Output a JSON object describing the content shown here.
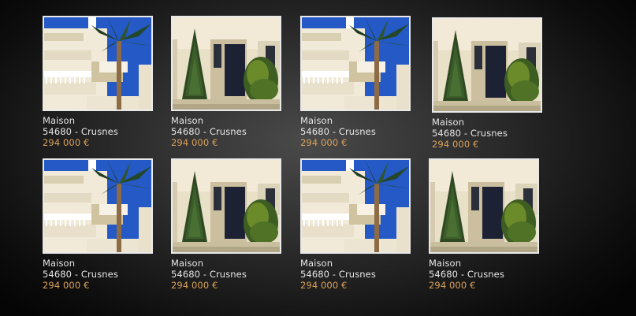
{
  "listings": [
    {
      "type": "Maison",
      "location": "54680 - Crusnes",
      "price": "294 000 €",
      "image": "white-apartment-balconies-palm-photo"
    },
    {
      "type": "Maison",
      "location": "54680 - Crusnes",
      "price": "294 000 €",
      "image": "cream-house-door-cypress-photo"
    },
    {
      "type": "Maison",
      "location": "54680 - Crusnes",
      "price": "294 000 €",
      "image": "white-apartment-balconies-palm-photo"
    },
    {
      "type": "Maison",
      "location": "54680 - Crusnes",
      "price": "294 000 €",
      "image": "cream-house-door-cypress-photo"
    },
    {
      "type": "Maison",
      "location": "54680 - Crusnes",
      "price": "294 000 €",
      "image": "white-apartment-balconies-palm-photo"
    },
    {
      "type": "Maison",
      "location": "54680 - Crusnes",
      "price": "294 000 €",
      "image": "cream-house-door-cypress-photo"
    },
    {
      "type": "Maison",
      "location": "54680 - Crusnes",
      "price": "294 000 €",
      "image": "white-apartment-balconies-palm-photo"
    },
    {
      "type": "Maison",
      "location": "54680 - Crusnes",
      "price": "294 000 €",
      "image": "cream-house-door-cypress-photo"
    }
  ],
  "colors": {
    "text": "#e6e6e6",
    "price": "#d9a15a",
    "border": "#e9e9e9"
  }
}
